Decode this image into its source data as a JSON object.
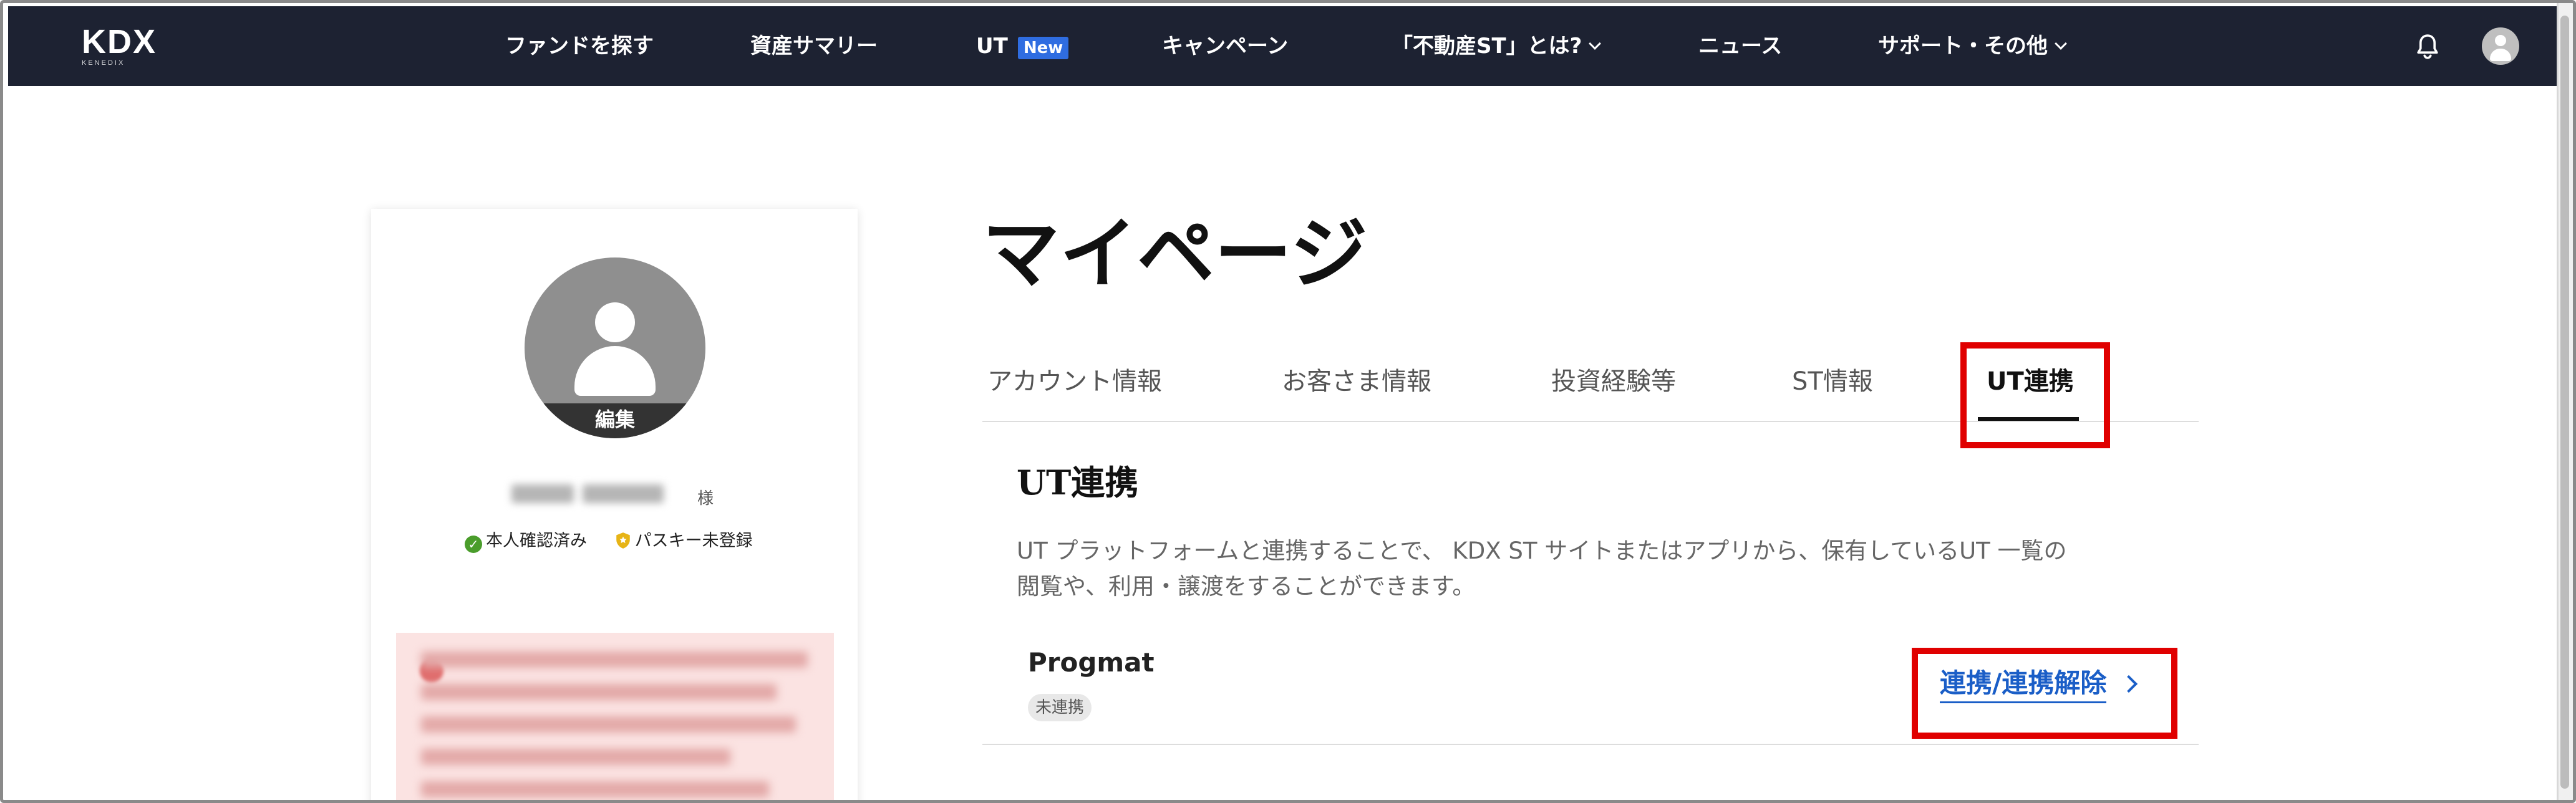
{
  "nav": {
    "logo": "KDX",
    "logo_sub": "KENEDIX",
    "items": [
      {
        "label": "ファンドを探す"
      },
      {
        "label": "資産サマリー"
      },
      {
        "label": "UT",
        "badge": "New"
      },
      {
        "label": "キャンペーン"
      },
      {
        "label": "「不動産ST」とは?"
      },
      {
        "label": "ニュース"
      },
      {
        "label": "サポート・その他"
      }
    ],
    "icons": [
      "bell-icon",
      "user-avatar-icon"
    ]
  },
  "profile": {
    "edit_label": "編集",
    "honorific": "様",
    "identity_status": "本人確認済み",
    "passkey_status": "パスキー未登録"
  },
  "page_title": "マイページ",
  "tabs": [
    {
      "label": "アカウント情報"
    },
    {
      "label": "お客さま情報"
    },
    {
      "label": "投資経験等"
    },
    {
      "label": "ST情報"
    },
    {
      "label": "UT連携",
      "active": true
    }
  ],
  "section": {
    "title": "UT連携",
    "description_line1": "UT プラットフォームと連携することで、 KDX ST サイトまたはアプリから、保有しているUT 一覧の",
    "description_line2": "閲覧や、利用・譲渡をすることができます。"
  },
  "progmat": {
    "name": "Progmat",
    "status": "未連携",
    "link_label": "連携/連携解除"
  },
  "colors": {
    "nav_bg": "#1d2232",
    "badge_new": "#2f6de1",
    "link": "#1a5ec7",
    "highlight": "#e00000",
    "verified": "#4a9d2b"
  }
}
